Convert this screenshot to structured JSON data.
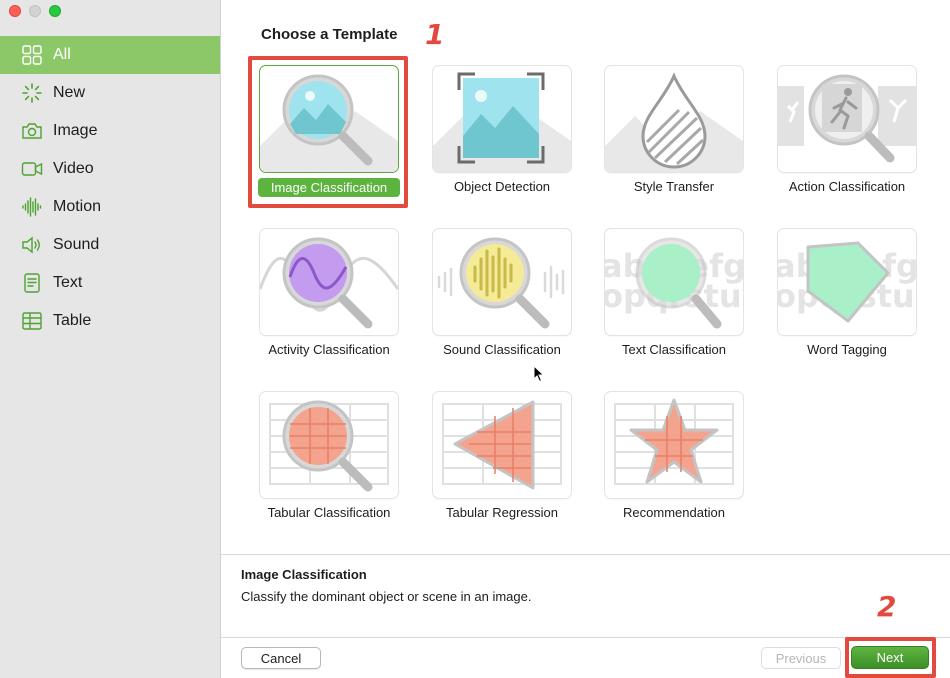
{
  "sidebar": {
    "items": [
      {
        "label": "All",
        "icon": "grid-icon"
      },
      {
        "label": "New",
        "icon": "spinner-icon"
      },
      {
        "label": "Image",
        "icon": "camera-icon"
      },
      {
        "label": "Video",
        "icon": "video-camera-icon"
      },
      {
        "label": "Motion",
        "icon": "waveform-icon"
      },
      {
        "label": "Sound",
        "icon": "speaker-icon"
      },
      {
        "label": "Text",
        "icon": "document-icon"
      },
      {
        "label": "Table",
        "icon": "table-icon"
      }
    ],
    "active_index": 0
  },
  "main": {
    "title": "Choose a Template",
    "templates": [
      {
        "label": "Image Classification",
        "selected": true
      },
      {
        "label": "Object Detection"
      },
      {
        "label": "Style Transfer"
      },
      {
        "label": "Action Classification"
      },
      {
        "label": "Activity Classification"
      },
      {
        "label": "Sound Classification"
      },
      {
        "label": "Text Classification"
      },
      {
        "label": "Word Tagging"
      },
      {
        "label": "Tabular Classification"
      },
      {
        "label": "Tabular Regression"
      },
      {
        "label": "Recommendation"
      }
    ],
    "thumb_text": {
      "line1": "abcdefghi",
      "line2": "opqrstuvw"
    }
  },
  "description": {
    "title": "Image Classification",
    "text": "Classify the dominant object or scene in an image."
  },
  "buttons": {
    "cancel": "Cancel",
    "previous": "Previous",
    "next": "Next"
  },
  "annotations": {
    "step1": "1",
    "step2": "2"
  },
  "colors": {
    "accent_green": "#8cc867",
    "button_green": "#4ea332",
    "annotation_red": "#e24a3e"
  }
}
